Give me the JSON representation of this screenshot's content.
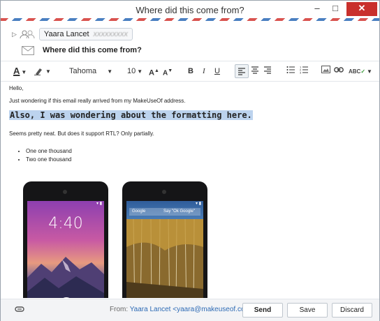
{
  "window": {
    "title": "Where did this come from?",
    "minimize": "–",
    "maximize": "□",
    "close": "✕"
  },
  "header": {
    "recipient_name": "Yaara Lancet",
    "recipient_address_obscured": "xxxxxxxxx",
    "subject": "Where did this come from?"
  },
  "toolbar": {
    "font_name": "Tahoma",
    "font_size": "10",
    "grow_font": "A",
    "shrink_font": "A",
    "bold": "B",
    "italic": "I",
    "underline": "U"
  },
  "body": {
    "greeting": "Hello,",
    "line1": "Just wondering if this email really arrived from my MakeUseOf address.",
    "headline": "Also, I was wondering about the formatting here.",
    "line2": "Seems pretty neat. But does it support RTL? Only partially.",
    "bullets": [
      "One one thousand",
      "Two one thousand"
    ],
    "phone1": {
      "time": "4:40",
      "date": ""
    },
    "phone2": {
      "search_label": "Google",
      "search_hint": "Say \"Ok Google\""
    }
  },
  "footer": {
    "from_label": "From:",
    "from_address": "Yaara Lancet <yaara@makeuseof.com>",
    "send": "Send",
    "save": "Save",
    "discard": "Discard"
  },
  "colors": {
    "accent": "#2e6bb5",
    "close": "#c9302c",
    "highlight": "#bcd3ee"
  }
}
